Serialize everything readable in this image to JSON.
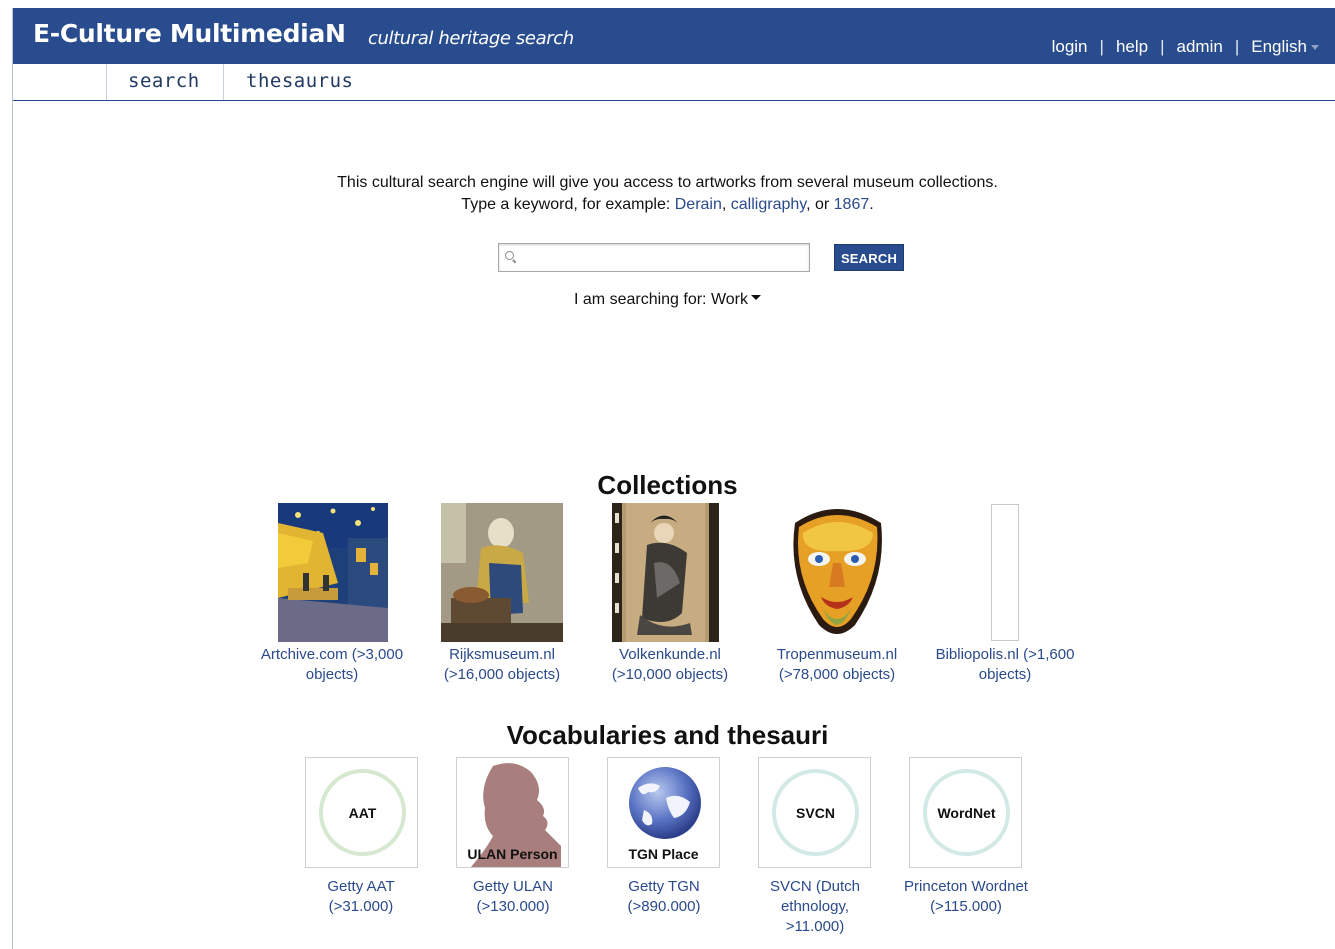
{
  "header": {
    "brand": "E-Culture MultimediaN",
    "tagline": "cultural heritage search",
    "links": [
      "login",
      "help",
      "admin",
      "English"
    ]
  },
  "nav": {
    "tabs": [
      "search",
      "thesaurus"
    ]
  },
  "intro": {
    "line1": "This cultural search engine will give you access to artworks from several museum collections.",
    "line2_prefix": "Type a keyword, for example:",
    "examples": [
      "Derain",
      "calligraphy",
      "1867"
    ],
    "sep1": ",",
    "sep2": ", or",
    "end": "."
  },
  "search": {
    "placeholder": "",
    "button": "SEARCH",
    "searching_for_label": "I am searching for:",
    "searching_for_value": "Work"
  },
  "collections": {
    "title": "Collections",
    "items": [
      {
        "line1": "Artchive.com (>3,000",
        "line2": "objects)",
        "icon": "cafe-terrace-painting"
      },
      {
        "line1": "Rijksmuseum.nl",
        "line2": "(>16,000 objects)",
        "icon": "milkmaid-painting"
      },
      {
        "line1": "Volkenkunde.nl",
        "line2": "(>10,000 objects)",
        "icon": "japanese-scroll"
      },
      {
        "line1": "Tropenmuseum.nl",
        "line2": "(>78,000 objects)",
        "icon": "mask"
      },
      {
        "line1": "Bibliopolis.nl (>1,600",
        "line2": "objects)",
        "icon": "blank-thumbnail"
      }
    ]
  },
  "vocabularies": {
    "title": "Vocabularies and thesauri",
    "items": [
      {
        "label": "AAT",
        "line1": "Getty AAT",
        "line2": "(>31.000)",
        "line3": "",
        "ring": "#d6e8cf"
      },
      {
        "label": "ULAN Person",
        "line1": "Getty ULAN",
        "line2": "(>130.000)",
        "line3": "",
        "icon": "person-silhouette"
      },
      {
        "label": "TGN Place",
        "line1": "Getty TGN",
        "line2": "(>890.000)",
        "line3": "",
        "icon": "globe"
      },
      {
        "label": "SVCN",
        "line1": "SVCN (Dutch",
        "line2": "ethnology,",
        "line3": ">11.000)",
        "ring": "#d3e9e6"
      },
      {
        "label": "WordNet",
        "line1": "Princeton Wordnet",
        "line2": "(>115.000)",
        "line3": "",
        "ring": "#d3e9e6"
      }
    ]
  },
  "colors": {
    "brand": "#284c8d",
    "link": "#2a4a8c"
  }
}
